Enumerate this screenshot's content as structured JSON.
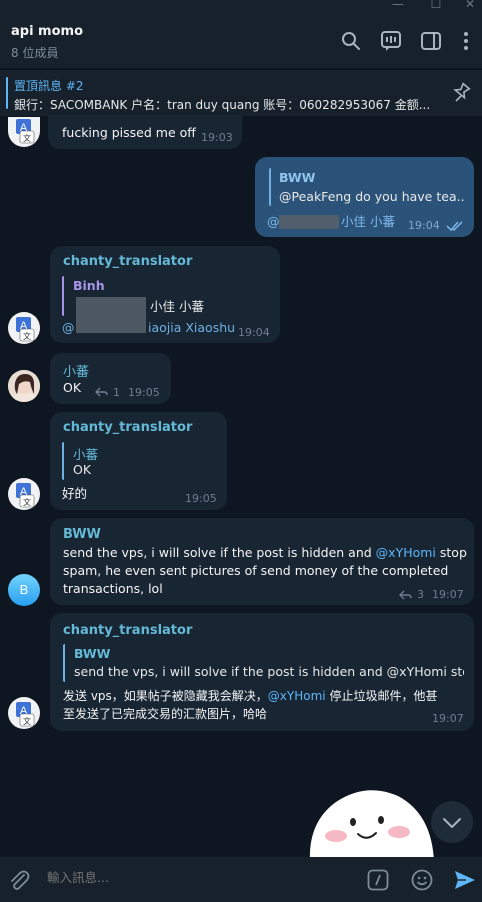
{
  "header": {
    "title": "api momo",
    "subtitle": "8 位成員"
  },
  "pinned": {
    "title": "置頂訊息 #2",
    "text": "銀行：SACOMBANK 户名：tran duy quang 账号：060282953067 金额..."
  },
  "messages": [
    {
      "text": "fucking pissed me off",
      "time": "19:03"
    },
    {
      "quote_name": "BWW",
      "quote_text": "@PeakFeng do you have tea...",
      "text_suffix": "小佳 小蕃",
      "text_prefix": "@",
      "time": "19:04"
    },
    {
      "sender": "chanty_translator",
      "quote_name": "Binh",
      "quote_text": "小佳 小蕃",
      "text_prefix": "@",
      "text_suffix": "iaojia Xiaoshu",
      "time": "19:04"
    },
    {
      "sender": "小蕃",
      "text": "OK",
      "reply_count": "1",
      "time": "19:05"
    },
    {
      "sender": "chanty_translator",
      "quote_name": "小蕃",
      "quote_text": "OK",
      "text": "好的",
      "time": "19:05"
    },
    {
      "sender": "BWW",
      "avatar_letter": "B",
      "line1_a": "send the vps, i will solve if the post is hidden and ",
      "line1_mention": "@xYHomi",
      "line1_b": " stop",
      "line2": "spam, he even sent pictures of send money of the completed",
      "line3": "transactions, lol",
      "reply_count": "3",
      "time": "19:07"
    },
    {
      "sender": "chanty_translator",
      "quote_name": "BWW",
      "quote_text": "send the vps, i will solve if the post is hidden and @xYHomi stop...",
      "line1_a": "发送 vps，如果帖子被隐藏我会解决，",
      "line1_mention": "@xYHomi",
      "line1_b": " 停止垃圾邮件，他甚",
      "line2": "至发送了已完成交易的汇款图片，哈哈",
      "time": "19:07"
    }
  ],
  "composer": {
    "placeholder": "輸入訊息..."
  },
  "colors": {
    "background": "#0e1621",
    "panel": "#17212b",
    "bubble_in": "#182533",
    "bubble_out": "#2b5278",
    "accent": "#5eb5f7",
    "translator_name": "#64b9d6",
    "binh_name": "#a695e7"
  },
  "icons": [
    "search-icon",
    "video-chat-icon",
    "sidebar-toggle-icon",
    "more-icon",
    "unpin-icon",
    "reply-icon",
    "double-check-icon",
    "attach-icon",
    "bot-commands-icon",
    "emoji-icon",
    "send-icon",
    "chevron-down-icon"
  ]
}
